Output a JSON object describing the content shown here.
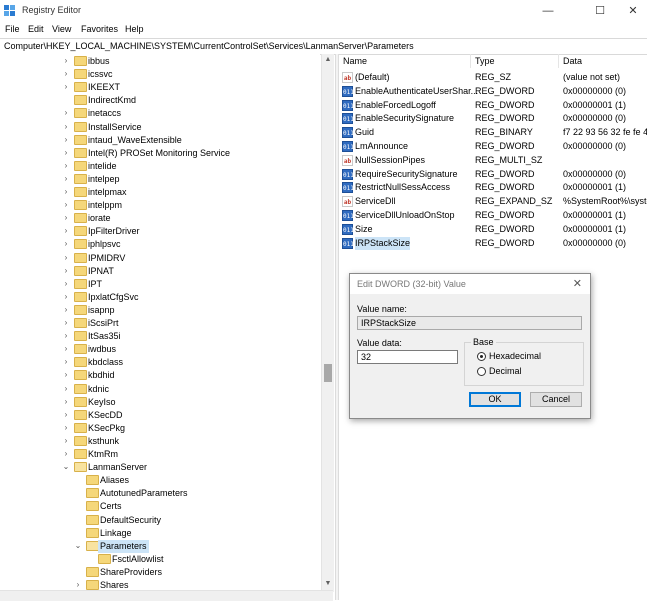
{
  "window": {
    "title": "Registry Editor",
    "minimize": "—",
    "maximize": "☐",
    "close": "✕"
  },
  "menu": [
    "File",
    "Edit",
    "View",
    "Favorites",
    "Help"
  ],
  "address": "Computer\\HKEY_LOCAL_MACHINE\\SYSTEM\\CurrentControlSet\\Services\\LanmanServer\\Parameters",
  "tree": [
    {
      "label": "ibbus",
      "arrow": ">",
      "selected": false
    },
    {
      "label": "icssvc",
      "arrow": ">",
      "selected": false
    },
    {
      "label": "IKEEXT",
      "arrow": ">",
      "selected": false
    },
    {
      "label": "IndirectKmd",
      "arrow": "",
      "selected": false
    },
    {
      "label": "inetaccs",
      "arrow": ">",
      "selected": false
    },
    {
      "label": "InstallService",
      "arrow": ">",
      "selected": false
    },
    {
      "label": "intaud_WaveExtensible",
      "arrow": ">",
      "selected": false
    },
    {
      "label": "Intel(R) PROSet Monitoring Service",
      "arrow": ">",
      "selected": false
    },
    {
      "label": "intelide",
      "arrow": ">",
      "selected": false
    },
    {
      "label": "intelpep",
      "arrow": ">",
      "selected": false
    },
    {
      "label": "intelpmax",
      "arrow": ">",
      "selected": false
    },
    {
      "label": "intelppm",
      "arrow": ">",
      "selected": false
    },
    {
      "label": "iorate",
      "arrow": ">",
      "selected": false
    },
    {
      "label": "IpFilterDriver",
      "arrow": ">",
      "selected": false
    },
    {
      "label": "iphlpsvc",
      "arrow": ">",
      "selected": false
    },
    {
      "label": "IPMIDRV",
      "arrow": ">",
      "selected": false
    },
    {
      "label": "IPNAT",
      "arrow": ">",
      "selected": false
    },
    {
      "label": "IPT",
      "arrow": ">",
      "selected": false
    },
    {
      "label": "IpxlatCfgSvc",
      "arrow": ">",
      "selected": false
    },
    {
      "label": "isapnp",
      "arrow": ">",
      "selected": false
    },
    {
      "label": "iScsiPrt",
      "arrow": ">",
      "selected": false
    },
    {
      "label": "ItSas35i",
      "arrow": ">",
      "selected": false
    },
    {
      "label": "iwdbus",
      "arrow": ">",
      "selected": false
    },
    {
      "label": "kbdclass",
      "arrow": ">",
      "selected": false
    },
    {
      "label": "kbdhid",
      "arrow": ">",
      "selected": false
    },
    {
      "label": "kdnic",
      "arrow": ">",
      "selected": false
    },
    {
      "label": "KeyIso",
      "arrow": ">",
      "selected": false
    },
    {
      "label": "KSecDD",
      "arrow": ">",
      "selected": false
    },
    {
      "label": "KSecPkg",
      "arrow": ">",
      "selected": false
    },
    {
      "label": "ksthunk",
      "arrow": ">",
      "selected": false
    },
    {
      "label": "KtmRm",
      "arrow": ">",
      "selected": false
    },
    {
      "label": "LanmanServer",
      "arrow": "v",
      "selected": false
    },
    {
      "label": "Aliases",
      "arrow": "",
      "selected": false
    },
    {
      "label": "AutotunedParameters",
      "arrow": "",
      "selected": false
    },
    {
      "label": "Certs",
      "arrow": "",
      "selected": false
    },
    {
      "label": "DefaultSecurity",
      "arrow": "",
      "selected": false
    },
    {
      "label": "Linkage",
      "arrow": "",
      "selected": false
    },
    {
      "label": "Parameters",
      "arrow": "v",
      "selected": true
    },
    {
      "label": "FsctlAllowlist",
      "arrow": "",
      "selected": false
    },
    {
      "label": "ShareProviders",
      "arrow": "",
      "selected": false
    },
    {
      "label": "Shares",
      "arrow": ">",
      "selected": false
    }
  ],
  "columns": {
    "name": "Name",
    "type": "Type",
    "data": "Data"
  },
  "values": [
    {
      "icon": "ab",
      "name": "(Default)",
      "type": "REG_SZ",
      "data": "(value not set)"
    },
    {
      "icon": "bin",
      "name": "EnableAuthenticateUserShar...",
      "type": "REG_DWORD",
      "data": "0x00000000 (0)"
    },
    {
      "icon": "bin",
      "name": "EnableForcedLogoff",
      "type": "REG_DWORD",
      "data": "0x00000001 (1)"
    },
    {
      "icon": "bin",
      "name": "EnableSecuritySignature",
      "type": "REG_DWORD",
      "data": "0x00000000 (0)"
    },
    {
      "icon": "bin",
      "name": "Guid",
      "type": "REG_BINARY",
      "data": "f7 22 93 56 32 fe fe 40 9"
    },
    {
      "icon": "bin",
      "name": "LmAnnounce",
      "type": "REG_DWORD",
      "data": "0x00000000 (0)"
    },
    {
      "icon": "ab",
      "name": "NullSessionPipes",
      "type": "REG_MULTI_SZ",
      "data": ""
    },
    {
      "icon": "bin",
      "name": "RequireSecuritySignature",
      "type": "REG_DWORD",
      "data": "0x00000000 (0)"
    },
    {
      "icon": "bin",
      "name": "RestrictNullSessAccess",
      "type": "REG_DWORD",
      "data": "0x00000001 (1)"
    },
    {
      "icon": "ab",
      "name": "ServiceDll",
      "type": "REG_EXPAND_SZ",
      "data": "%SystemRoot%\\syster"
    },
    {
      "icon": "bin",
      "name": "ServiceDllUnloadOnStop",
      "type": "REG_DWORD",
      "data": "0x00000001 (1)"
    },
    {
      "icon": "bin",
      "name": "Size",
      "type": "REG_DWORD",
      "data": "0x00000001 (1)"
    },
    {
      "icon": "bin",
      "name": "IRPStackSize",
      "type": "REG_DWORD",
      "data": "0x00000000 (0)"
    }
  ],
  "dialog": {
    "title": "Edit DWORD (32-bit) Value",
    "value_name_label": "Value name:",
    "value_name": "IRPStackSize",
    "value_data_label": "Value data:",
    "value_data": "32",
    "base_label": "Base",
    "hex_label": "Hexadecimal",
    "dec_label": "Decimal",
    "ok": "OK",
    "cancel": "Cancel"
  },
  "colors": {
    "selection": "#cce4f7",
    "folder": "#f5d77a",
    "accent": "#0078d7"
  }
}
